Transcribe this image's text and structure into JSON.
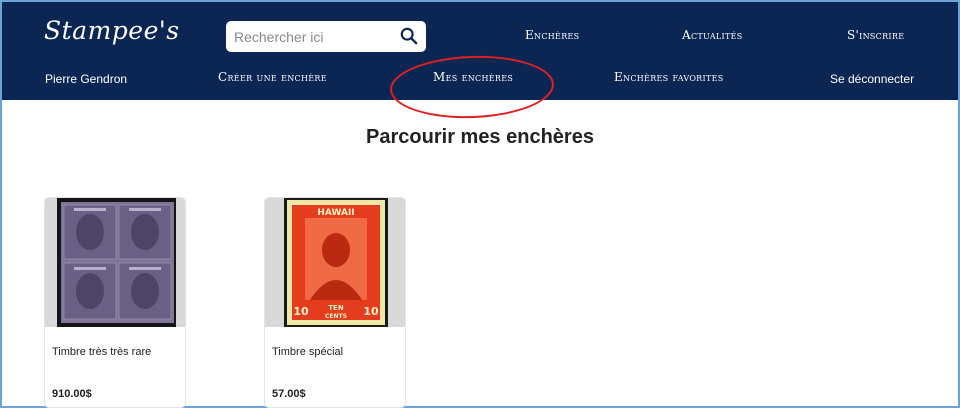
{
  "header": {
    "logo": "Stampee's",
    "search": {
      "placeholder": "Rechercher ici"
    },
    "nav_top": [
      "Enchères",
      "Actualités",
      "S'inscrire"
    ],
    "nav_bottom": {
      "user": "Pierre Gendron",
      "create": "Créer une enchère",
      "mine": "Mes enchères",
      "favorites": "Enchères favorites",
      "logout": "Se déconnecter"
    }
  },
  "colors": {
    "header_bg": "#0c2654",
    "highlight": "#e02020"
  },
  "main": {
    "title": "Parcourir mes enchères",
    "cards": [
      {
        "name": "Timbre très très rare",
        "price": "910.00$",
        "image": "purple-victoria-stamp-block"
      },
      {
        "name": "Timbre spécial",
        "price": "57.00$",
        "image": "red-hawaii-ten-cents-stamp",
        "stamp_text": {
          "top": "HAWAII",
          "value": "10",
          "word": "TEN",
          "bottom": "CENTS"
        }
      }
    ]
  }
}
